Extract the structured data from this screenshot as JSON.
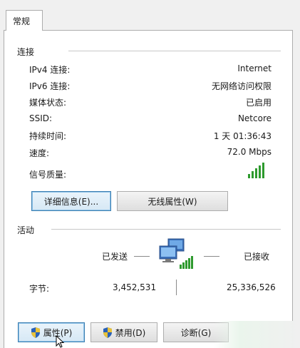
{
  "tabs": [
    {
      "label": "常规"
    }
  ],
  "connection": {
    "title": "连接",
    "rows": [
      {
        "label": "IPv4 连接:",
        "value": "Internet"
      },
      {
        "label": "IPv6 连接:",
        "value": "无网络访问权限"
      },
      {
        "label": "媒体状态:",
        "value": "已启用"
      },
      {
        "label": "SSID:",
        "value": "Netcore"
      },
      {
        "label": "持续时间:",
        "value": "1 天 01:36:43"
      },
      {
        "label": "速度:",
        "value": "72.0 Mbps"
      },
      {
        "label": "信号质量:",
        "value": ""
      }
    ],
    "signal_level": 1.0,
    "details_button": "详细信息(E)...",
    "wireless_props_button": "无线属性(W)"
  },
  "activity": {
    "title": "活动",
    "sent_label": "已发送",
    "received_label": "已接收",
    "bytes_label": "字节:",
    "bytes_sent": "3,452,531",
    "bytes_received": "25,336,526"
  },
  "buttons": {
    "properties": "属性(P)",
    "disable": "禁用(D)",
    "diagnose": "诊断(G)"
  },
  "colors": {
    "signal": "#2e9a2e",
    "focus_border": "#3c7fb1",
    "panel_border": "#adadad"
  }
}
